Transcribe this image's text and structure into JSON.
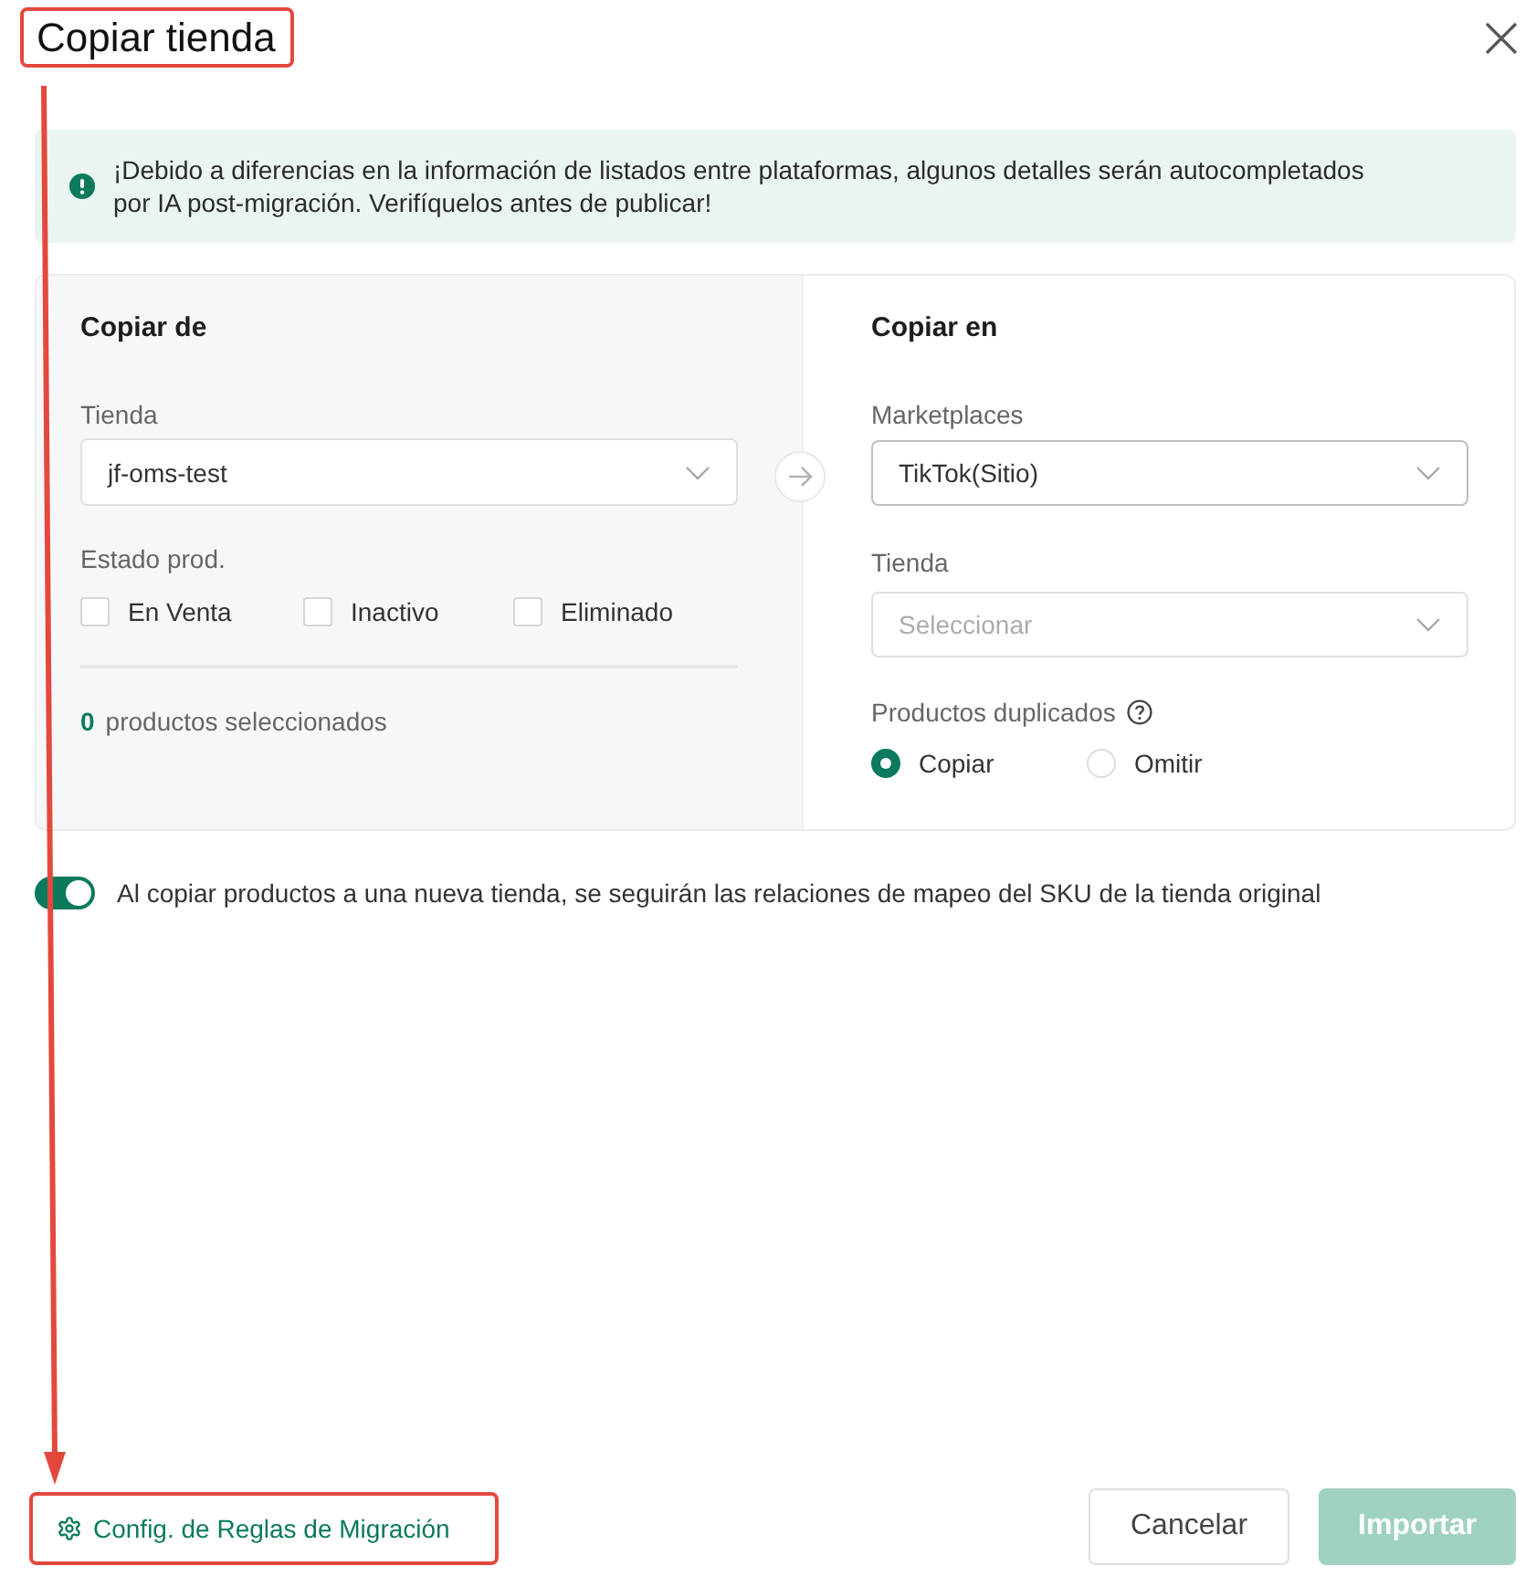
{
  "dialog": {
    "title": "Copiar tienda"
  },
  "notice": {
    "text": "¡Debido a diferencias en la información de listados entre plataformas, algunos detalles serán autocompletados por IA post-migración. Verifíquelos antes de publicar!"
  },
  "copy_from": {
    "heading": "Copiar de",
    "store_label": "Tienda",
    "store_value": "jf-oms-test",
    "status_label": "Estado prod.",
    "statuses": [
      {
        "label": "En Venta",
        "checked": false
      },
      {
        "label": "Inactivo",
        "checked": false
      },
      {
        "label": "Eliminado",
        "checked": false
      }
    ],
    "selected_count": "0",
    "selected_text": "productos seleccionados"
  },
  "copy_to": {
    "heading": "Copiar en",
    "marketplace_label": "Marketplaces",
    "marketplace_value": "TikTok(Sitio)",
    "store_label": "Tienda",
    "store_placeholder": "Seleccionar",
    "duplicates_label": "Productos duplicados",
    "duplicate_options": [
      {
        "label": "Copiar",
        "selected": true
      },
      {
        "label": "Omitir",
        "selected": false
      }
    ]
  },
  "sku_mapping": {
    "on": true,
    "text": "Al copiar productos a una nueva tienda, se seguirán las relaciones de mapeo del SKU de la tienda original"
  },
  "footer": {
    "rules_link": "Config. de Reglas de Migración",
    "buttons": [
      {
        "label": "Cancelar",
        "kind": "secondary",
        "disabled": false
      },
      {
        "label": "Importar",
        "kind": "primary",
        "disabled": true
      }
    ]
  }
}
